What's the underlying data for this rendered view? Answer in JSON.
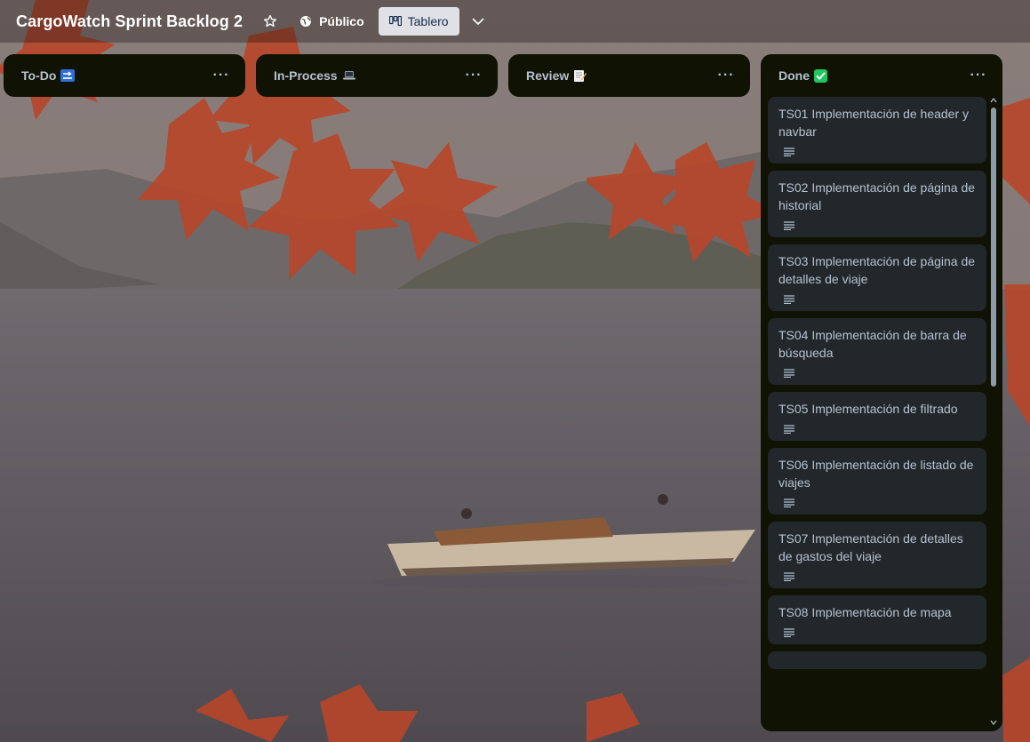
{
  "board": {
    "title": "CargoWatch Sprint Backlog 2",
    "visibility_label": "Público",
    "view_label": "Tablero"
  },
  "lists": [
    {
      "title": "To-Do",
      "emoji": "soon-arrow-icon"
    },
    {
      "title": "In-Process",
      "emoji": "laptop-icon"
    },
    {
      "title": "Review",
      "emoji": "memo-icon"
    },
    {
      "title": "Done",
      "emoji": "check-mark-button-icon",
      "cards": [
        "TS01 Implementación de header y navbar",
        "TS02 Implementación de página de historial",
        "TS03 Implementación de página de detalles de viaje",
        "TS04 Implementación de barra de búsqueda",
        "TS05 Implementación de filtrado",
        "TS06 Implementación de listado de viajes",
        "TS07 Implementación de detalles de gastos del viaje",
        "TS08 Implementación de mapa"
      ]
    }
  ],
  "colors": {
    "list_bg": "#101204",
    "card_bg": "#22272b",
    "text": "#b6c2cf",
    "done_emoji": "#22c55e"
  }
}
